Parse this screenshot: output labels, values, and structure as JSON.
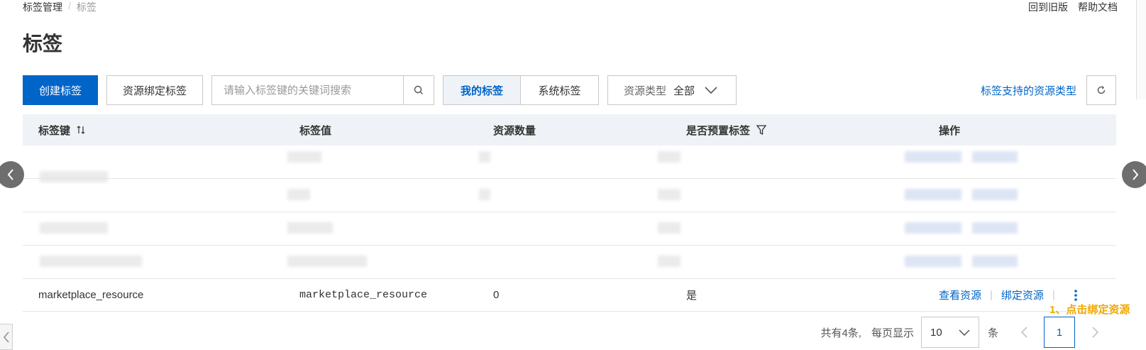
{
  "breadcrumb": {
    "items": [
      "标签管理",
      "标签"
    ],
    "separator": "/"
  },
  "top_links": {
    "old_version": "回到旧版",
    "help": "帮助文档"
  },
  "page_title": "标签",
  "toolbar": {
    "create_label": "创建标签",
    "bind_label": "资源绑定标签",
    "search_placeholder": "请输入标签键的关键词搜索",
    "my_tags": "我的标签",
    "system_tags": "系统标签",
    "resource_type_label": "资源类型",
    "resource_type_value": "全部",
    "support_link": "标签支持的资源类型"
  },
  "table": {
    "headers": {
      "key": "标签键",
      "value": "标签值",
      "count": "资源数量",
      "preset": "是否预置标签",
      "actions": "操作"
    },
    "row": {
      "key": "marketplace_resource",
      "value": "marketplace_resource",
      "count": "0",
      "preset": "是",
      "action_view": "查看资源",
      "action_bind": "绑定资源"
    }
  },
  "annotation": "1、点击绑定资源",
  "pagination": {
    "total": "共有4条,",
    "per_page_label": "每页显示",
    "per_page_value": "10",
    "unit": "条",
    "current_page": "1"
  },
  "colors": {
    "primary": "#0064c8",
    "annotation": "#f0a800",
    "header_bg": "#eff3f8"
  }
}
